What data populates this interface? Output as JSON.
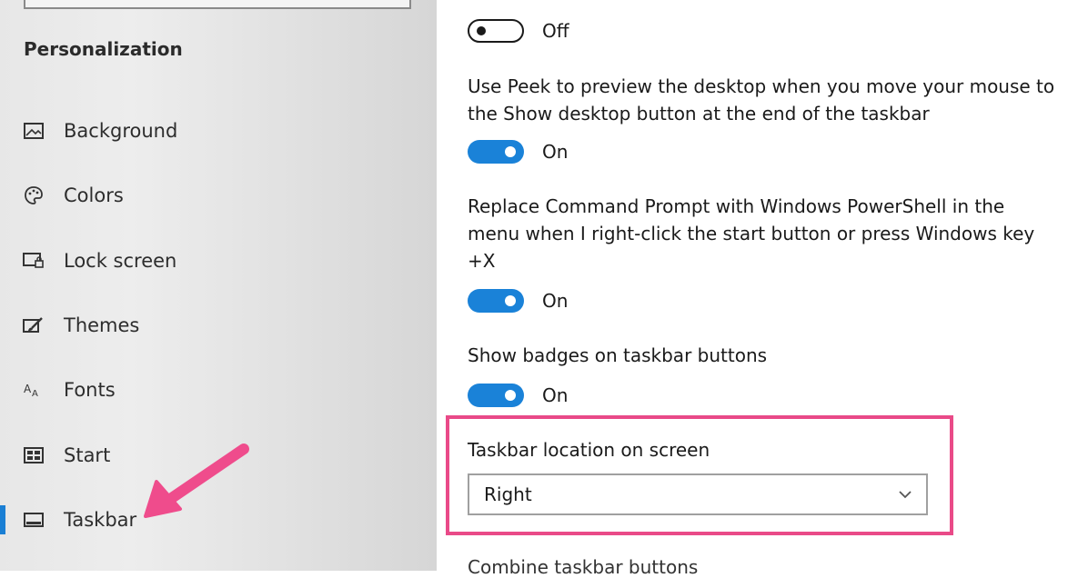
{
  "sidebar": {
    "section_title": "Personalization",
    "items": [
      {
        "label": "Background",
        "icon": "picture-icon"
      },
      {
        "label": "Colors",
        "icon": "palette-icon"
      },
      {
        "label": "Lock screen",
        "icon": "lock-screen-icon"
      },
      {
        "label": "Themes",
        "icon": "brush-icon"
      },
      {
        "label": "Fonts",
        "icon": "font-icon"
      },
      {
        "label": "Start",
        "icon": "start-tiles-icon"
      },
      {
        "label": "Taskbar",
        "icon": "taskbar-icon",
        "active": true
      }
    ],
    "accent_color": "#1a7fd4"
  },
  "main": {
    "top_toggle_state": "Off",
    "settings": [
      {
        "text": "Use Peek to preview the desktop when you move your mouse to the Show desktop button at the end of the taskbar",
        "state": "On"
      },
      {
        "text": "Replace Command Prompt with Windows PowerShell in the menu when I right-click the start button or press Windows key +X",
        "state": "On"
      },
      {
        "text": "Show badges on taskbar buttons",
        "state": "On"
      }
    ],
    "location": {
      "label": "Taskbar location on screen",
      "value": "Right"
    },
    "next_heading_partial": "Combine taskbar buttons"
  },
  "colors": {
    "toggle_on": "#1a82d8",
    "highlight": "#e94a88",
    "arrow": "#ef4c8c"
  }
}
